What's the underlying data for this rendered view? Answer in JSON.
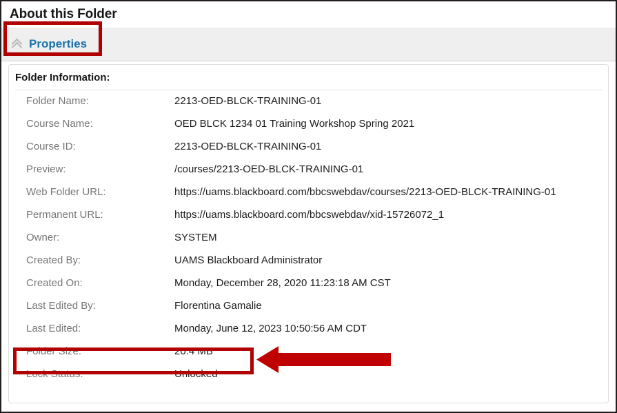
{
  "page": {
    "title": "About this Folder"
  },
  "tabs": [
    {
      "label": "Properties",
      "icon": "chevron-up-double-icon",
      "selected": true,
      "highlight_color": "#b00000"
    }
  ],
  "section": {
    "heading": "Folder Information:"
  },
  "folder_information": [
    {
      "label": "Folder Name:",
      "value": "2213-OED-BLCK-TRAINING-01"
    },
    {
      "label": "Course Name:",
      "value": "OED BLCK 1234 01 Training Workshop Spring 2021"
    },
    {
      "label": "Course ID:",
      "value": "2213-OED-BLCK-TRAINING-01"
    },
    {
      "label": "Preview:",
      "value": "/courses/2213-OED-BLCK-TRAINING-01"
    },
    {
      "label": "Web Folder URL:",
      "value": "https://uams.blackboard.com/bbcswebdav/courses/2213-OED-BLCK-TRAINING-01"
    },
    {
      "label": "Permanent URL:",
      "value": "https://uams.blackboard.com/bbcswebdav/xid-15726072_1"
    },
    {
      "label": "Owner:",
      "value": "SYSTEM"
    },
    {
      "label": "Created By:",
      "value": "UAMS Blackboard Administrator"
    },
    {
      "label": "Created On:",
      "value": "Monday, December 28, 2020 11:23:18 AM CST"
    },
    {
      "label": "Last Edited By:",
      "value": "Florentina Gamalie"
    },
    {
      "label": "Last Edited:",
      "value": "Monday, June 12, 2023 10:50:56 AM CDT"
    },
    {
      "label": "Folder Size:",
      "value": "20.4 MB"
    },
    {
      "label": "Lock Status:",
      "value": "Unlocked"
    }
  ],
  "annotations": {
    "arrow": {
      "name": "red-left-arrow",
      "direction": "left",
      "color": "#c00000",
      "points_at": "Folder Size:"
    },
    "boxes": [
      {
        "name": "properties-tab-highlight",
        "color": "#b00000"
      },
      {
        "name": "folder-size-row-highlight",
        "color": "#b00000"
      }
    ]
  },
  "colors": {
    "link": "#1a73a7",
    "label_text": "#767676",
    "value_text": "#1c1c1c",
    "tab_background": "#efefef",
    "annotation_red": "#b00000",
    "arrow_red": "#c00000"
  }
}
